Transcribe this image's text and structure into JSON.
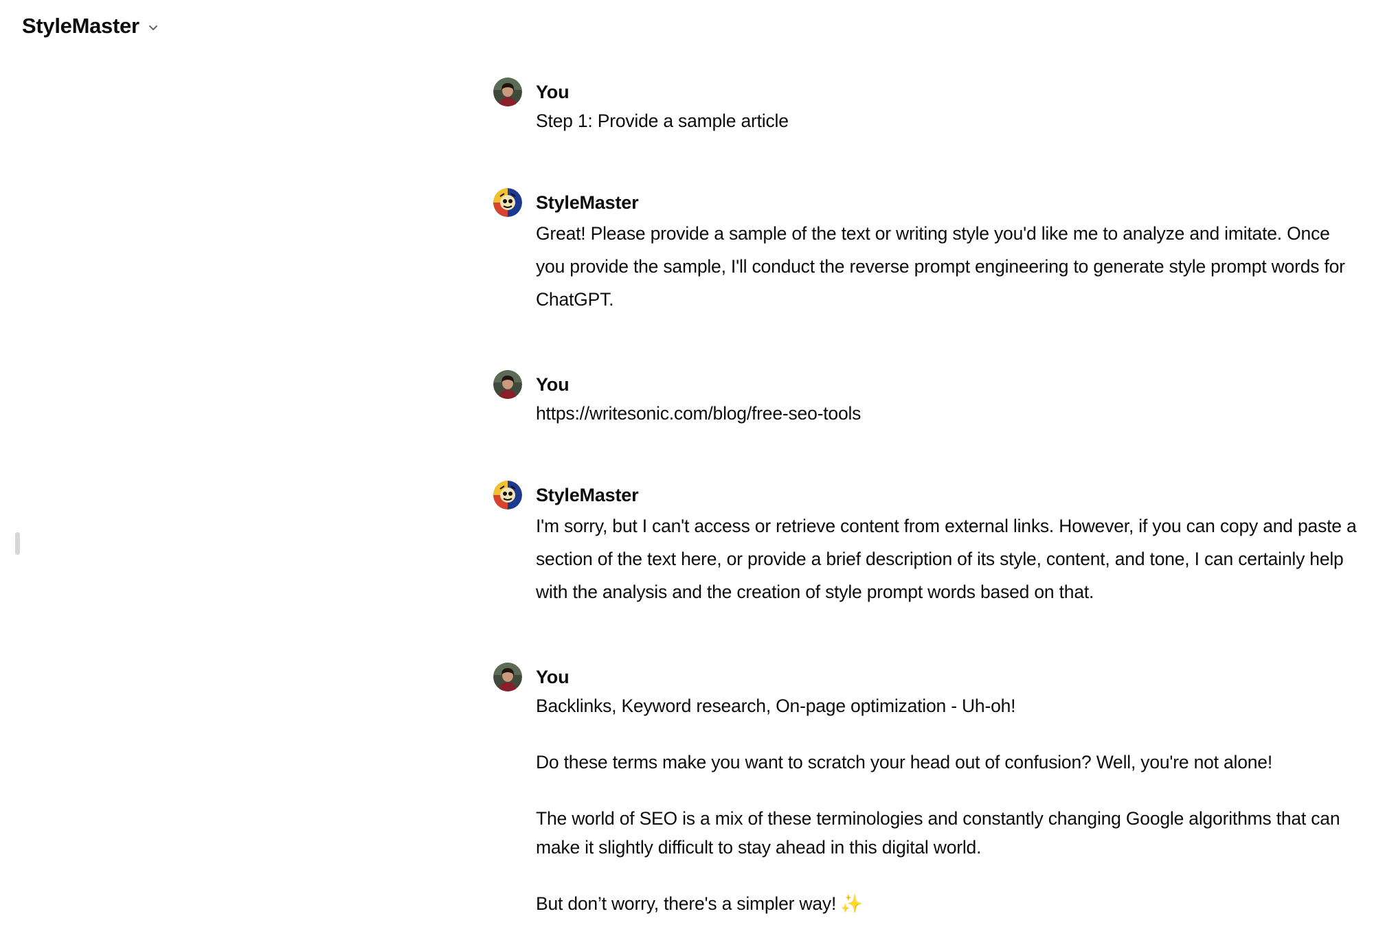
{
  "header": {
    "title": "StyleMaster",
    "chevron_icon": "chevron-down-icon"
  },
  "thread": [
    {
      "role": "user",
      "author": "You",
      "avatar_icon": "user-avatar",
      "paragraphs": [
        "Step 1: Provide a sample article"
      ]
    },
    {
      "role": "assistant",
      "author": "StyleMaster",
      "avatar_icon": "stylemaster-avatar",
      "paragraphs": [
        "Great! Please provide a sample of the text or writing style you'd like me to analyze and imitate. Once you provide the sample, I'll conduct the reverse prompt engineering to generate style prompt words for ChatGPT."
      ]
    },
    {
      "role": "user",
      "author": "You",
      "avatar_icon": "user-avatar",
      "paragraphs": [
        "https://writesonic.com/blog/free-seo-tools"
      ]
    },
    {
      "role": "assistant",
      "author": "StyleMaster",
      "avatar_icon": "stylemaster-avatar",
      "paragraphs": [
        "I'm sorry, but I can't access or retrieve content from external links. However, if you can copy and paste a section of the text here, or provide a brief description of its style, content, and tone, I can certainly help with the analysis and the creation of style prompt words based on that."
      ]
    },
    {
      "role": "user",
      "author": "You",
      "avatar_icon": "user-avatar",
      "paragraphs": [
        "Backlinks, Keyword research, On-page optimization - Uh-oh!",
        "Do these terms make you want to scratch your head out of confusion? Well, you're not alone!",
        "The world of SEO is a mix of these terminologies and constantly changing Google algorithms that can make it slightly difficult to stay ahead in this digital world.",
        "But don’t worry, there's a simpler way!"
      ],
      "trailing_emoji": "✨"
    }
  ],
  "colors": {
    "text": "#0d0d0d",
    "background": "#ffffff",
    "handle": "#d6d6d6",
    "sparkle": "#f0c419"
  }
}
